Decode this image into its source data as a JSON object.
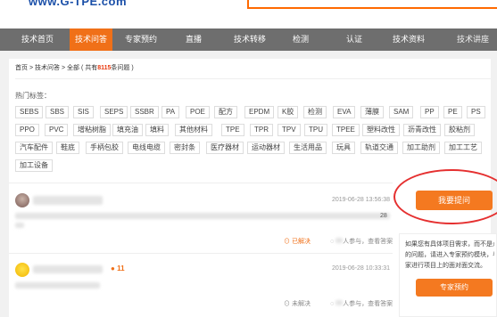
{
  "header": {
    "logo_text": "www.G-TPE.com"
  },
  "nav": {
    "items": [
      "技术首页",
      "技术问答",
      "专家预约",
      "直播",
      "技术转移",
      "检测",
      "认证",
      "技术资料",
      "技术讲座"
    ],
    "active_index": 1
  },
  "breadcrumb": {
    "home": "首页",
    "sep1": ">",
    "section": "技术问答",
    "sep2": ">",
    "all": "全部",
    "count_prefix": "( 共有",
    "count": "8115",
    "count_suffix": "条问题 )"
  },
  "tags": {
    "title": "热门标签：",
    "rows": [
      [
        "SEBS",
        "SBS",
        "SIS",
        "SEPS",
        "SSBR",
        "PA",
        "POE",
        "配方",
        "EPDM",
        "K胶",
        "检测",
        "EVA",
        "薄膜",
        "SAM",
        "PP",
        "PE",
        "PS"
      ],
      [
        "PPO",
        "PVC",
        "增粘树脂",
        "填充油",
        "填料",
        "其他材料",
        "TPE",
        "TPR",
        "TPV",
        "TPU",
        "TPEE",
        "塑料改性",
        "沥青改性",
        "胶粘剂"
      ],
      [
        "汽车配件",
        "鞋底",
        "手柄包胶",
        "电线电缆",
        "密封条",
        "医疗器材",
        "运动器材",
        "生活用品",
        "玩具",
        "轨道交通",
        "加工助剂",
        "加工工艺"
      ],
      [
        "加工设备"
      ]
    ]
  },
  "questions": [
    {
      "timestamp": "2019-06-28 13:56:38",
      "status": "已解决",
      "status_color": "#f07018",
      "side_number": "28",
      "participation": "人参与，查看答案"
    },
    {
      "timestamp": "2019-06-28 10:33:31",
      "status": "未解决",
      "status_color": "#888888",
      "badge_count": "11",
      "participation": "人参与，查看答案"
    }
  ],
  "sidebar": {
    "ask_button": "我要提问",
    "info_lines": [
      "如果您有具体项目需求，而不是点",
      "的问题，请进入专家预约模块，与",
      "家进行项目上的面对面交流。"
    ],
    "expert_button": "专家预约"
  },
  "colors": {
    "accent": "#f47920",
    "nav_bg": "#6e6e6e",
    "highlight": "#e8380d"
  }
}
